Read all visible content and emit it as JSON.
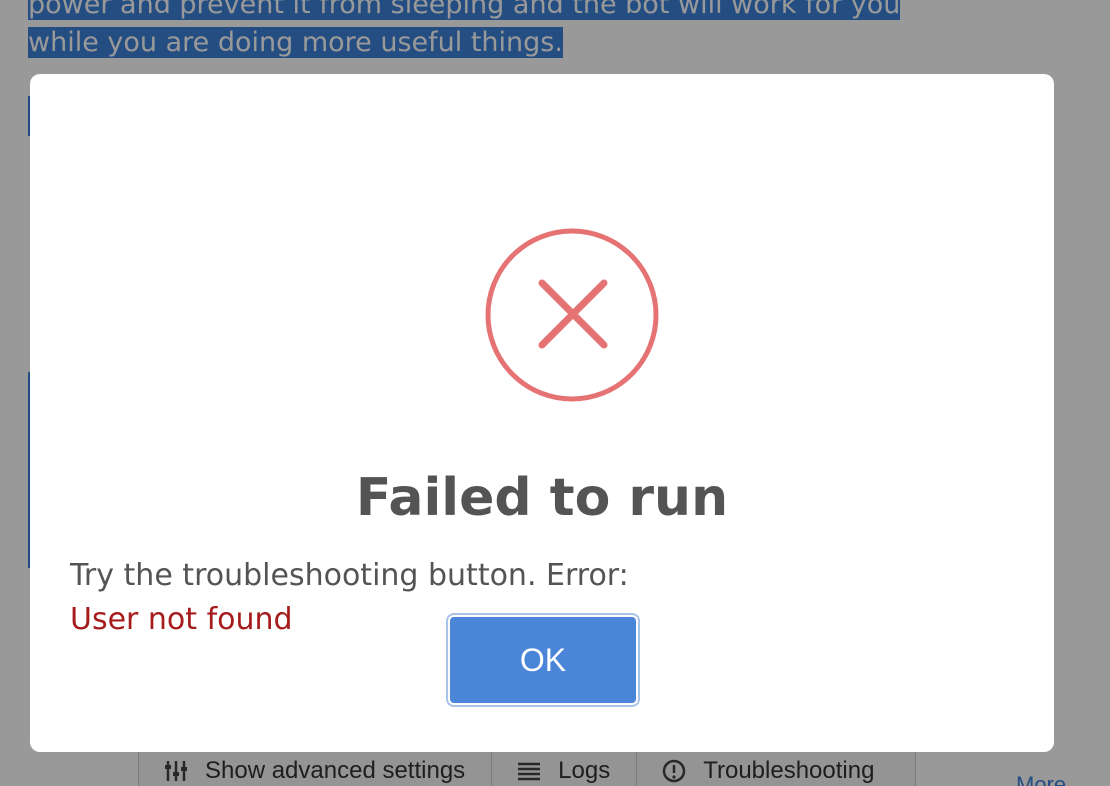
{
  "background": {
    "paragraph_lines": [
      "power and prevent it from sleeping and the bot will work for you",
      "while you are doing more useful things."
    ],
    "toolbar": {
      "advanced_label": "Show advanced settings",
      "logs_label": "Logs",
      "troubleshooting_label": "Troubleshooting"
    },
    "more_link": "More"
  },
  "dialog": {
    "icon": "error-x-circle-icon",
    "icon_color": "#e57373",
    "title": "Failed to run",
    "message": "Try the troubleshooting button. Error:",
    "error_text": "User not found",
    "ok_label": "OK"
  },
  "colors": {
    "accent": "#4a85d8",
    "error_text": "#a61c1c",
    "selection": "#3d80d8"
  }
}
